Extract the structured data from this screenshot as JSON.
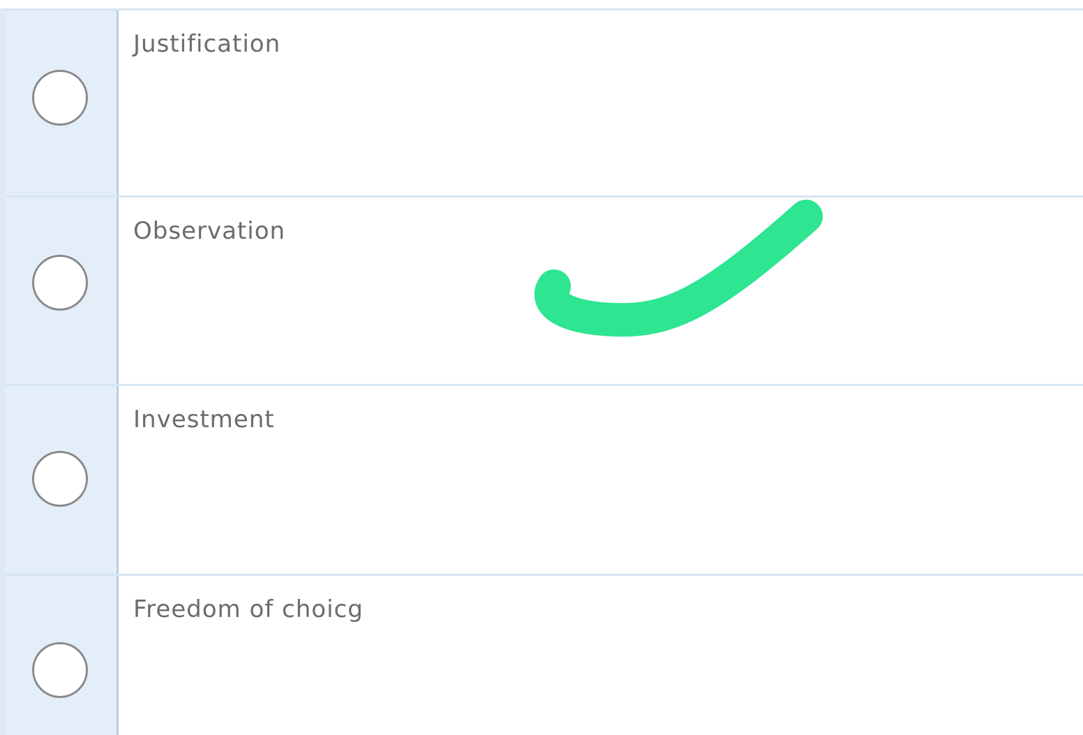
{
  "options": [
    {
      "label": "Justification",
      "selected": false
    },
    {
      "label": "Observation",
      "selected": false
    },
    {
      "label": "Investment",
      "selected": false
    },
    {
      "label": "Freedom of choicg",
      "selected": false
    }
  ],
  "annotation": {
    "icon": "checkmark-icon",
    "color": "#2ee591",
    "marked_option": "Observation"
  }
}
